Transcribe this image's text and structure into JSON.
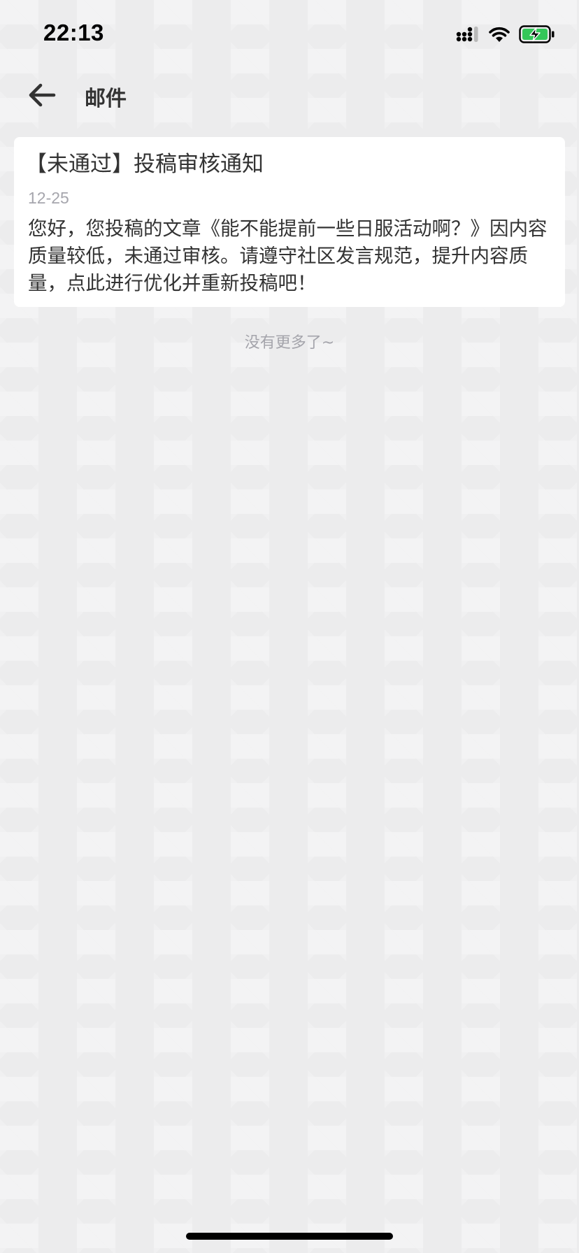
{
  "status_bar": {
    "time": "22:13",
    "icons": [
      "signal-icon",
      "wifi-icon",
      "battery-charging-icon"
    ],
    "battery_color": "#34c759"
  },
  "nav": {
    "back_icon": "arrow-left-icon",
    "title": "邮件"
  },
  "mail": {
    "title": "【未通过】投稿审核通知",
    "date": "12-25",
    "body": "您好，您投稿的文章《能不能提前一些日服活动啊？》因内容质量较低，未通过审核。请遵守社区发言规范，提升内容质量，点此进行优化并重新投稿吧！"
  },
  "footer": {
    "no_more": "没有更多了~"
  }
}
